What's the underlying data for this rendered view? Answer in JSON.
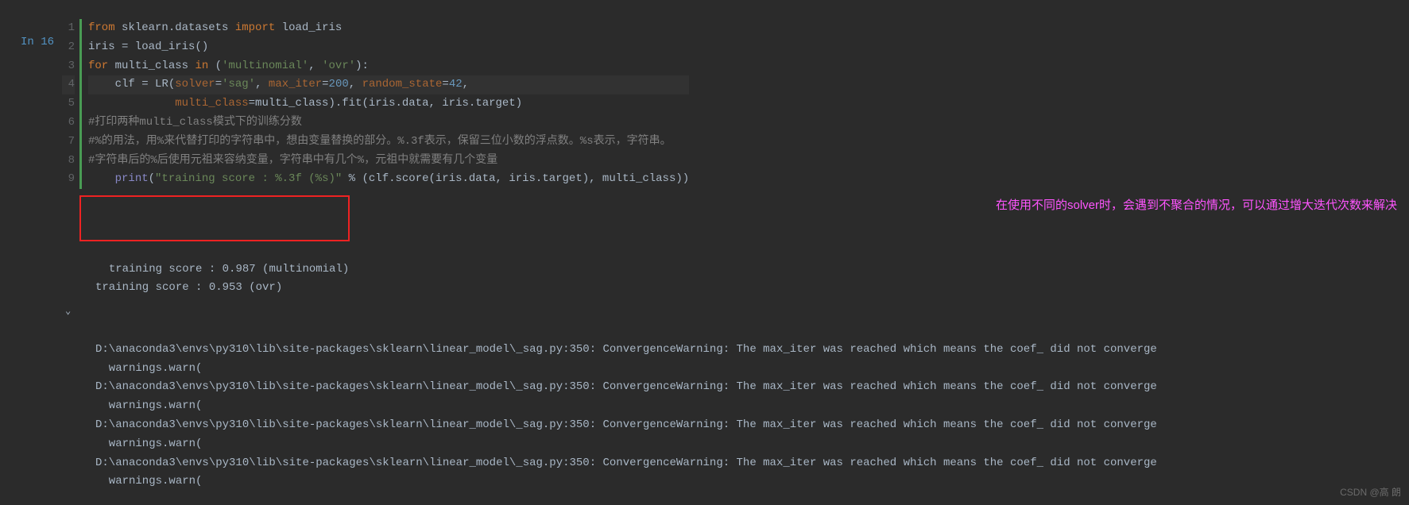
{
  "prompt": {
    "label": "In",
    "number": "16"
  },
  "gutter": [
    "1",
    "2",
    "3",
    "4",
    "5",
    "6",
    "7",
    "8",
    "9"
  ],
  "code": {
    "l1": {
      "kw1": "from",
      "mod": "sklearn.datasets",
      "kw2": "import",
      "name": "load_iris"
    },
    "l2": {
      "text": "iris = load_iris()"
    },
    "l3": {
      "kw": "for",
      "var": "multi_class",
      "kw2": "in",
      "s1": "'multinomial'",
      "s2": "'ovr'",
      "colon": ":"
    },
    "l4": {
      "indent": "    ",
      "var": "clf",
      "eq": " = ",
      "fn": "LR",
      "p1": "solver",
      "v1": "'sag'",
      "p2": "max_iter",
      "v2": "200",
      "p3": "random_state",
      "v3": "42",
      "comma": ","
    },
    "l5": {
      "indent": "             ",
      "p": "multi_class",
      "eq": "=multi_class).fit(iris.data, iris.target)"
    },
    "l6": "#打印两种multi_class模式下的训练分数",
    "l7": "#%的用法，用%来代替打印的字符串中，想由变量替换的部分。%.3f表示，保留三位小数的浮点数。%s表示，字符串。",
    "l8": "#字符串后的%后使用元祖来容纳变量，字符串中有几个%，元祖中就需要有几个变量",
    "l9": {
      "indent": "    ",
      "fn": "print",
      "s": "\"training score : %.3f (%s)\"",
      "rest": " % (clf.score(iris.data, iris.target), multi_class))"
    }
  },
  "output": {
    "line1": "training score : 0.987 (multinomial)",
    "line2": "training score : 0.953 (ovr)"
  },
  "annotation": "在使用不同的solver时，会遇到不聚合的情况，可以通过增大迭代次数来解决",
  "warnings": {
    "w1": "D:\\anaconda3\\envs\\py310\\lib\\site-packages\\sklearn\\linear_model\\_sag.py:350: ConvergenceWarning: The max_iter was reached which means the coef_ did not converge",
    "w1b": "  warnings.warn(",
    "w2": "D:\\anaconda3\\envs\\py310\\lib\\site-packages\\sklearn\\linear_model\\_sag.py:350: ConvergenceWarning: The max_iter was reached which means the coef_ did not converge",
    "w2b": "  warnings.warn(",
    "w3": "D:\\anaconda3\\envs\\py310\\lib\\site-packages\\sklearn\\linear_model\\_sag.py:350: ConvergenceWarning: The max_iter was reached which means the coef_ did not converge",
    "w3b": "  warnings.warn(",
    "w4": "D:\\anaconda3\\envs\\py310\\lib\\site-packages\\sklearn\\linear_model\\_sag.py:350: ConvergenceWarning: The max_iter was reached which means the coef_ did not converge",
    "w4b": "  warnings.warn("
  },
  "watermark": "CSDN @高 朗"
}
